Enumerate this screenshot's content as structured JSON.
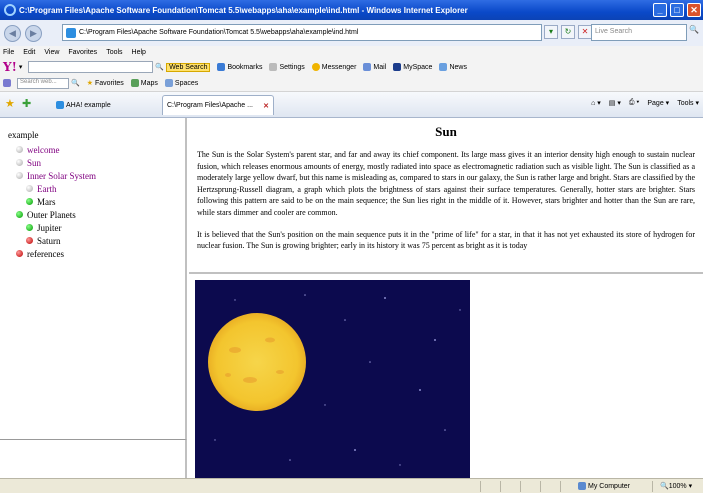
{
  "window": {
    "title": "C:\\Program Files\\Apache Software Foundation\\Tomcat 5.5\\webapps\\aha\\example\\ind.html - Windows Internet Explorer"
  },
  "address": {
    "url": "C:\\Program Files\\Apache Software Foundation\\Tomcat 5.5\\webapps\\aha\\example\\ind.html",
    "search_placeholder": "Live Search"
  },
  "menu": [
    "File",
    "Edit",
    "View",
    "Favorites",
    "Tools",
    "Help"
  ],
  "yahoo": {
    "logo": "Y!",
    "search_button": "Web Search",
    "items_row1": [
      "Bookmarks",
      "Settings",
      "Messenger",
      "Mail",
      "MySpace",
      "News"
    ],
    "search_placeholder2": "Search web...",
    "items_row2": [
      "Favorites",
      "Maps",
      "Spaces"
    ]
  },
  "tabs": [
    {
      "label": "AHA! example"
    },
    {
      "label": "C:\\Program Files\\Apache ..."
    }
  ],
  "right_tools": [
    "Page",
    "Tools"
  ],
  "tree": {
    "root": "example",
    "items": [
      {
        "label": "welcome",
        "bullet": "grey",
        "style": "link",
        "indent": 1
      },
      {
        "label": "Sun",
        "bullet": "grey",
        "style": "link",
        "indent": 1
      },
      {
        "label": "Inner Solar System",
        "bullet": "grey",
        "style": "link",
        "indent": 1
      },
      {
        "label": "Earth",
        "bullet": "grey",
        "style": "link",
        "indent": 2
      },
      {
        "label": "Mars",
        "bullet": "green",
        "style": "plain",
        "indent": 2
      },
      {
        "label": "Outer Planets",
        "bullet": "green",
        "style": "plain",
        "indent": 1
      },
      {
        "label": "Jupiter",
        "bullet": "green",
        "style": "plain",
        "indent": 2
      },
      {
        "label": "Saturn",
        "bullet": "red",
        "style": "plain",
        "indent": 2
      },
      {
        "label": "references",
        "bullet": "red",
        "style": "plain",
        "indent": 1
      }
    ]
  },
  "article": {
    "title": "Sun",
    "p1": "The Sun is the Solar System's parent star, and far and away its chief component. Its large mass gives it an interior density high enough to sustain nuclear fusion, which releases enormous amounts of energy, mostly radiated into space as electromagnetic radiation such as visible light. The Sun is classified as a moderately large yellow dwarf, but this name is misleading as, compared to stars in our galaxy, the Sun is rather large and bright. Stars are classified by the Hertzsprung-Russell diagram, a graph which plots the brightness of stars against their surface temperatures. Generally, hotter stars are brighter. Stars following this pattern are said to be on the main sequence; the Sun lies right in the middle of it. However, stars brighter and hotter than the Sun are rare, while stars dimmer and cooler are common.",
    "p2": "It is believed that the Sun's position on the main sequence puts it in the \"prime of life\" for a star, in that it has not yet exhausted its store of hydrogen for nuclear fusion. The Sun is growing brighter; early in its history it was 75 percent as bright as it is today"
  },
  "status": {
    "zone": "My Computer",
    "zoom": "100%"
  },
  "colors": {
    "link": "#800080",
    "space": "#0c0a4e",
    "sun": "#f7d23c"
  }
}
